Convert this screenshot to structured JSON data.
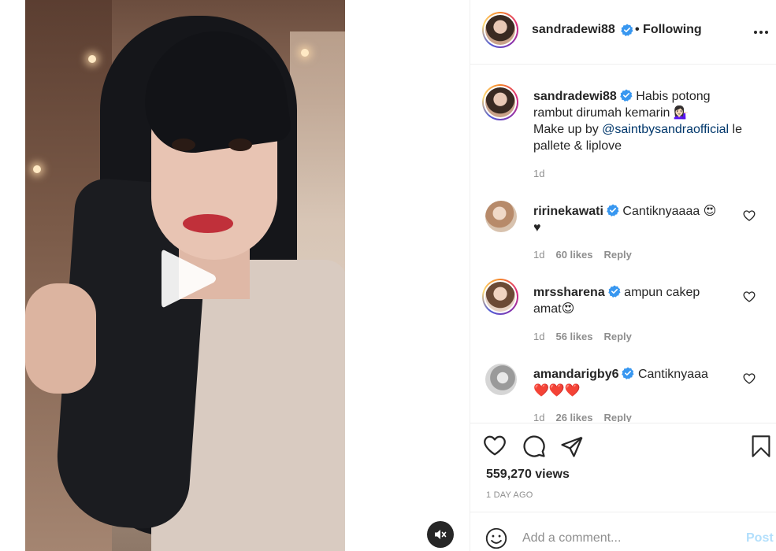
{
  "post": {
    "username": "sandradewi88",
    "follow_status": "• Following",
    "more_icon": "more-horizontal-icon"
  },
  "caption": {
    "username": "sandradewi88",
    "line1": "Habis potong",
    "line2": "rambut dirumah kemarin 💁🏻‍♀️",
    "line3_prefix": "Make up by ",
    "mention": "@saintbysandraofficial",
    "line3_suffix": " le",
    "line4": "pallete & liplove",
    "time": "1d"
  },
  "comments": [
    {
      "username": "ririnekawati",
      "text": "Cantiknyaaaa 😍",
      "text2": "♥",
      "time": "1d",
      "likes": "60 likes",
      "reply": "Reply"
    },
    {
      "username": "mrssharena",
      "text": "ampun cakep",
      "text2": "amat😍",
      "time": "1d",
      "likes": "56 likes",
      "reply": "Reply"
    },
    {
      "username": "amandarigby6",
      "text": "Cantiknyaaa",
      "text2": "❤️❤️❤️",
      "time": "1d",
      "likes": "26 likes",
      "reply": "Reply"
    }
  ],
  "stats": {
    "views": "559,270 views",
    "date": "1 DAY AGO"
  },
  "comment_box": {
    "placeholder": "Add a comment...",
    "post_label": "Post"
  },
  "colors": {
    "verified": "#3897f0",
    "link": "#00376b",
    "muted": "#8e8e8e",
    "post_disabled": "#b2dffc"
  }
}
